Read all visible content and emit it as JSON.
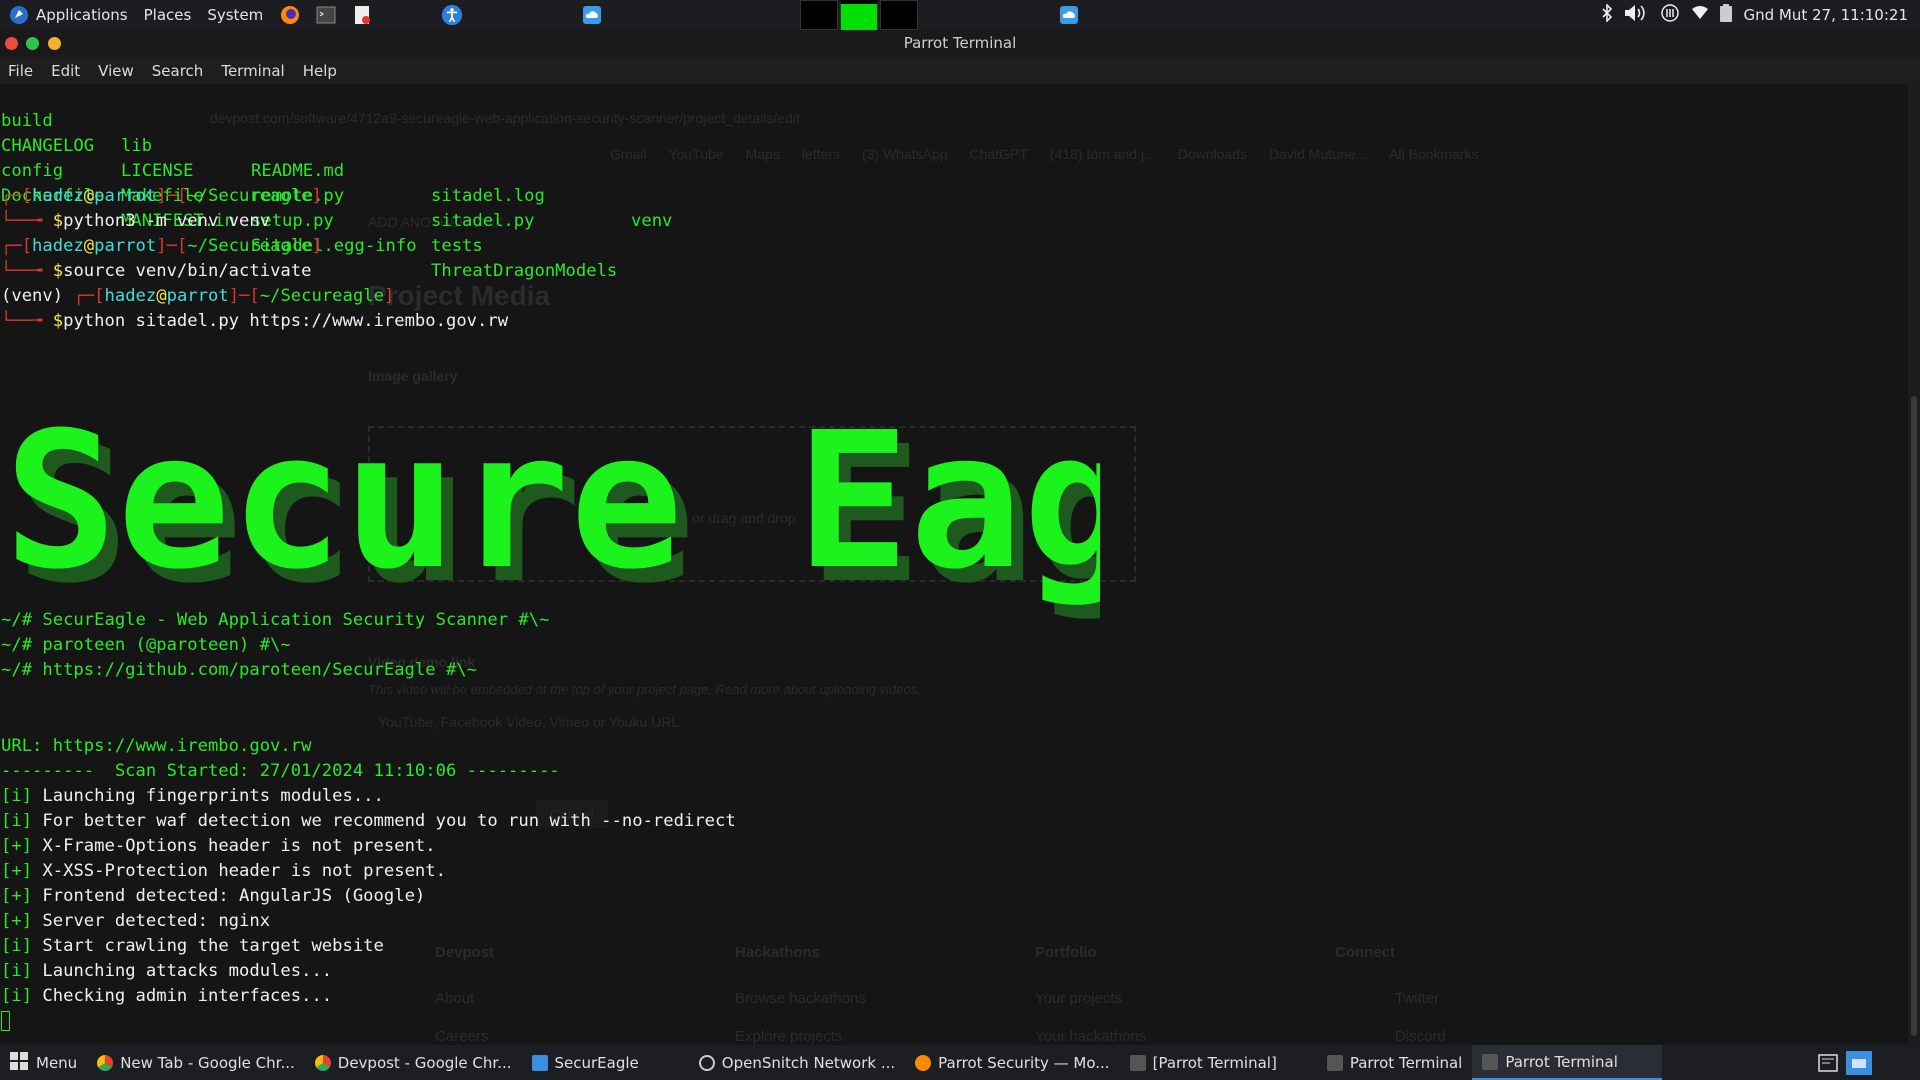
{
  "top_panel": {
    "applications": "Applications",
    "places": "Places",
    "system": "System",
    "clock": "Gnd Mut 27, 11:10:21"
  },
  "window": {
    "title": "Parrot Terminal",
    "menu": [
      "File",
      "Edit",
      "View",
      "Search",
      "Terminal",
      "Help"
    ]
  },
  "terminal": {
    "ls_rows": [
      [
        "build",
        "lib",
        "README.md",
        "sitadel.log",
        "venv"
      ],
      [
        "CHANGELOG",
        "LICENSE",
        "remote.py",
        "sitadel.py",
        ""
      ],
      [
        "config",
        "Makefile",
        "setup.py",
        "tests",
        ""
      ],
      [
        "Dockerfile",
        "MANIFEST.in",
        "Sitadel.egg-info",
        "ThreatDragonModels",
        ""
      ]
    ],
    "prompt_user": "hadez",
    "prompt_host": "parrot",
    "prompt_dir": "~/Secureagle",
    "commands": [
      "python3 -m venv venv",
      "source venv/bin/activate",
      "python sitadel.py https://www.irembo.gov.rw"
    ],
    "venv_prefix": "(venv)",
    "banner": "Secure Eagle",
    "info_lines": [
      "~/# SecurEagle - Web Application Security Scanner #\\~",
      "~/# paroteen (@paroteen) #\\~",
      "~/# https://github.com/paroteen/SecurEagle #\\~"
    ],
    "url_line": "URL: https://www.irembo.gov.rw",
    "scan_started": "---------  Scan Started: 27/01/2024 11:10:06 ---------",
    "log": [
      {
        "tag": "[i]",
        "text": "Launching fingerprints modules..."
      },
      {
        "tag": "[i]",
        "text": "For better waf detection we recommend you to run with --no-redirect"
      },
      {
        "tag": "[+]",
        "text": "X-Frame-Options header is not present."
      },
      {
        "tag": "[+]",
        "text": "X-XSS-Protection header is not present."
      },
      {
        "tag": "[+]",
        "text": "Frontend detected: AngularJS (Google)"
      },
      {
        "tag": "[+]",
        "text": "Server detected: nginx"
      },
      {
        "tag": "[i]",
        "text": "Start crawling the target website"
      },
      {
        "tag": "[i]",
        "text": "Launching attacks modules..."
      },
      {
        "tag": "[i]",
        "text": "Checking admin interfaces..."
      }
    ]
  },
  "background_ghost": {
    "url": "devpost.com/software/4712a9-secureagle-web-application-security-scanner/project_details/edit",
    "bookmarks": [
      "Gmail",
      "YouTube",
      "Maps",
      "letters",
      "(3) WhatsApp",
      "ChatGPT",
      "(418) tom and j...",
      "Downloads",
      "David Mutune...",
      "All Bookmarks"
    ],
    "add_link": "ADD ANOTHER LINK",
    "project_media": "Project Media",
    "image_gallery": "Image gallery",
    "drag_drop": "or drag and drop",
    "video_demo": "Video demo link",
    "video_help": "This video will be embedded at the top of your project page. Read more about uploading videos.",
    "video_placeholder": "YouTube, Facebook Video, Vimeo or Youku URL",
    "cancel": "Cancel",
    "footer_cols": [
      "Devpost",
      "Hackathons",
      "Portfolio",
      "Connect"
    ],
    "footer_links": [
      "About",
      "Browse hackathons",
      "Your projects",
      "Twitter",
      "Careers",
      "Explore projects",
      "Your hackathons",
      "Discord"
    ]
  },
  "taskbar": {
    "menu": "Menu",
    "tasks": [
      {
        "label": "New Tab - Google Chr...",
        "icon": "chrome-icon",
        "color": "#e94235"
      },
      {
        "label": "Devpost - Google Chr...",
        "icon": "chrome-icon",
        "color": "#e94235"
      },
      {
        "label": "SecurEagle",
        "icon": "folder-icon",
        "color": "#3b8fe0"
      },
      {
        "label": "OpenSnitch Network ...",
        "icon": "opensnitch-icon",
        "color": "#cccccc"
      },
      {
        "label": "Parrot Security — Mo...",
        "icon": "firefox-icon",
        "color": "#ff8a00"
      },
      {
        "label": "[Parrot Terminal]",
        "icon": "terminal-icon",
        "color": "#555555"
      },
      {
        "label": "Parrot Terminal",
        "icon": "terminal-icon",
        "color": "#555555"
      },
      {
        "label": "Parrot Terminal",
        "icon": "terminal-icon",
        "color": "#555555"
      }
    ]
  }
}
